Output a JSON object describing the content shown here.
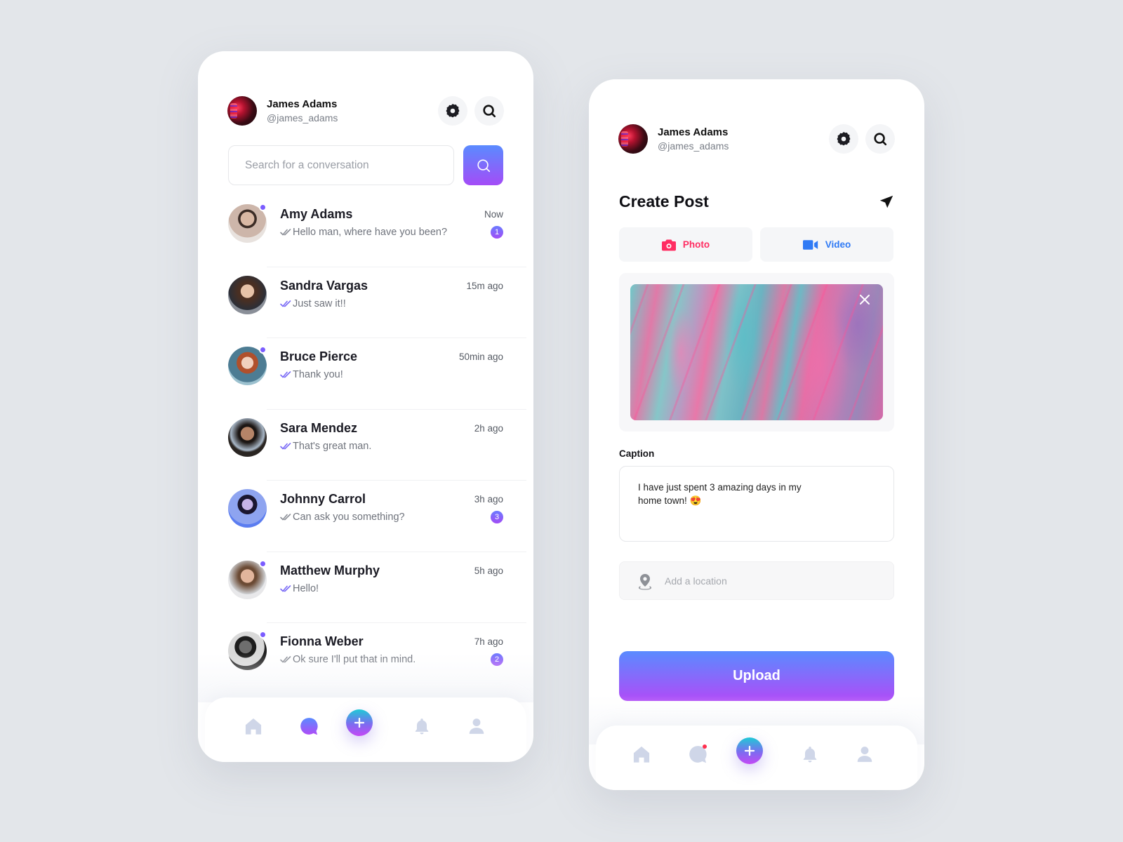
{
  "user": {
    "name": "James Adams",
    "handle": "@james_adams"
  },
  "messages_screen": {
    "search": {
      "placeholder": "Search for a conversation",
      "value": ""
    },
    "conversations": [
      {
        "name": "Amy Adams",
        "message": "Hello man, where have you been?",
        "time": "Now",
        "unread": "1",
        "online": true,
        "read": false
      },
      {
        "name": "Sandra Vargas",
        "message": "Just saw it!!",
        "time": "15m ago",
        "unread": null,
        "online": false,
        "read": true
      },
      {
        "name": "Bruce Pierce",
        "message": "Thank you!",
        "time": "50min ago",
        "unread": null,
        "online": true,
        "read": true
      },
      {
        "name": "Sara Mendez",
        "message": "That's great man.",
        "time": "2h ago",
        "unread": null,
        "online": false,
        "read": true
      },
      {
        "name": "Johnny Carrol",
        "message": "Can ask you something?",
        "time": "3h ago",
        "unread": "3",
        "online": false,
        "read": false
      },
      {
        "name": "Matthew Murphy",
        "message": "Hello!",
        "time": "5h ago",
        "unread": null,
        "online": true,
        "read": true
      },
      {
        "name": "Fionna Weber",
        "message": "Ok sure I'll put that in mind.",
        "time": "7h ago",
        "unread": "2",
        "online": true,
        "read": false
      }
    ],
    "bottom_nav": {
      "active": "messages",
      "items": [
        "home-icon",
        "chat-icon",
        "plus-icon",
        "bell-icon",
        "profile-icon"
      ]
    }
  },
  "create_post_screen": {
    "title": "Create Post",
    "media_buttons": {
      "photo": "Photo",
      "video": "Video"
    },
    "caption_label": "Caption",
    "caption_value": "I have just spent 3 amazing days in my\nhome town! 😍",
    "location_placeholder": "Add a location",
    "upload_label": "Upload",
    "bottom_nav": {
      "active": "add",
      "chat_has_notification": true,
      "items": [
        "home-icon",
        "chat-icon",
        "plus-icon",
        "bell-icon",
        "profile-icon"
      ]
    }
  },
  "colors": {
    "accent_gradient_top": "#5a8bff",
    "accent_gradient_bottom": "#b04bf7",
    "photo": "#ff2d62",
    "video": "#2f7af5",
    "online_dot": "#7a5cff",
    "notification_dot": "#ff2f4e",
    "nav_inactive": "#cfd6e8"
  }
}
